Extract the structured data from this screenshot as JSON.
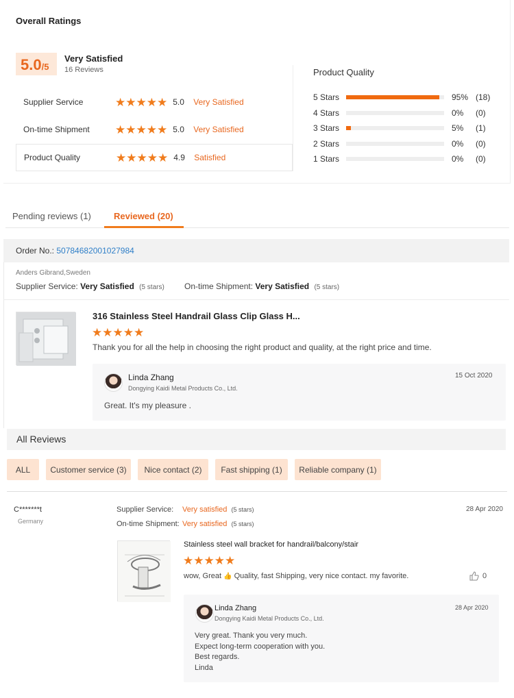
{
  "overall": {
    "title": "Overall Ratings",
    "score": "5.0",
    "score_max": "/5",
    "summary": "Very Satisfied",
    "reviews_count": "16 Reviews",
    "rows": [
      {
        "label": "Supplier Service",
        "value": "5.0",
        "word": "Very Satisfied",
        "stars": 5
      },
      {
        "label": "On-time Shipment",
        "value": "5.0",
        "word": "Very Satisfied",
        "stars": 5
      },
      {
        "label": "Product Quality",
        "value": "4.9",
        "word": "Satisfied",
        "stars": 5
      }
    ]
  },
  "product_quality": {
    "title": "Product Quality",
    "rows": [
      {
        "label": "5 Stars",
        "pct": "95%",
        "count": "(18)",
        "fraction": 0.95
      },
      {
        "label": "4 Stars",
        "pct": "0%",
        "count": "(0)",
        "fraction": 0
      },
      {
        "label": "3 Stars",
        "pct": "5%",
        "count": "(1)",
        "fraction": 0.05
      },
      {
        "label": "2 Stars",
        "pct": "0%",
        "count": "(0)",
        "fraction": 0
      },
      {
        "label": "1 Stars",
        "pct": "0%",
        "count": "(0)",
        "fraction": 0
      }
    ]
  },
  "tabs": {
    "pending": "Pending reviews (1)",
    "reviewed": "Reviewed (20)"
  },
  "order": {
    "label": "Order No.:",
    "number": "5078468200102798​4",
    "reviewer": "Anders Gibrand,Sweden",
    "service_label": "Supplier Service:",
    "service_value": "Very Satisfied",
    "service_stars": "(5 stars)",
    "shipment_label": "On-time Shipment:",
    "shipment_value": "Very Satisfied",
    "shipment_stars": "(5 stars)",
    "product_title": "316 Stainless Steel Handrail Glass Clip Glass H...",
    "comment": "Thank you for all the help in choosing the right product and quality, at the right price and time.",
    "reply": {
      "name": "Linda Zhang",
      "company": "Dongying Kaidi Metal Products Co., Ltd.",
      "date": "15 Oct 2020",
      "text": "Great. It's my pleasure ."
    }
  },
  "all_reviews": {
    "title": "All Reviews",
    "chips": [
      "ALL",
      "Customer service (3)",
      "Nice contact (2)",
      "Fast shipping (1)",
      "Reliable company (1)"
    ]
  },
  "review": {
    "user": "C*******t",
    "country": "Germany",
    "service_label": "Supplier Service:",
    "service_value": "Very satisfied",
    "service_stars": "(5 stars)",
    "shipment_label": "On-time Shipment:",
    "shipment_value": "Very satisfied",
    "shipment_stars": "(5 stars)",
    "date": "28 Apr 2020",
    "product_title": "Stainless steel wall bracket for handrail/balcony/stair",
    "comment_before": "wow, Great",
    "comment_after": "Quality, fast Shipping, very nice contact. my favorite.",
    "likes": "0",
    "reply": {
      "name": "Linda Zhang",
      "company": "Dongying Kaidi Metal Products Co., Ltd.",
      "date": "28 Apr 2020",
      "lines": [
        "Very great. Thank you very much.",
        "Expect long-term cooperation with you.",
        "Best regards.",
        "Linda"
      ]
    }
  },
  "colors": {
    "accent": "#e8671f",
    "bar_fill": "#f06a10",
    "chip_bg": "#fde3d1",
    "link": "#2f7fc8"
  }
}
